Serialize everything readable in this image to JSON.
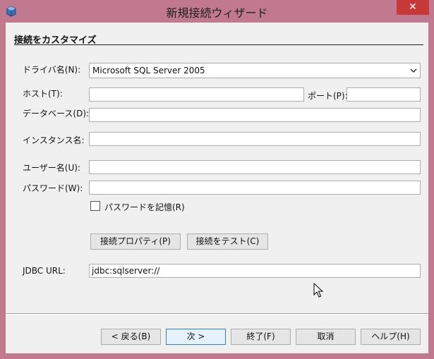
{
  "window": {
    "title": "新規接続ウィザード",
    "close_glyph": "✕",
    "close_color": "#c73838",
    "frame_color": "#c0798f",
    "icon": "database-app-icon"
  },
  "section": {
    "title": "接続をカスタマイズ"
  },
  "form": {
    "driver": {
      "label": "ドライバ名(N):",
      "value": "Microsoft SQL Server 2005"
    },
    "host": {
      "label": "ホスト(T):",
      "value": ""
    },
    "port": {
      "label": "ポート(P):",
      "value": ""
    },
    "database": {
      "label": "データベース(D):",
      "value": ""
    },
    "instance": {
      "label": "インスタンス名:",
      "value": ""
    },
    "username": {
      "label": "ユーザー名(U):",
      "value": ""
    },
    "password": {
      "label": "パスワード(W):",
      "value": ""
    },
    "remember": {
      "label": "パスワードを記憶(R)",
      "checked": false
    },
    "conn_props_button": "接続プロパティ(P)",
    "test_button": "接続をテスト(C)",
    "jdbc": {
      "label": "JDBC URL:",
      "value": "jdbc:sqlserver://"
    }
  },
  "footer": {
    "back": "< 戻る(B)",
    "next": "次 >",
    "finish": "終了(F)",
    "cancel": "取消",
    "help": "ヘルプ(H)"
  }
}
